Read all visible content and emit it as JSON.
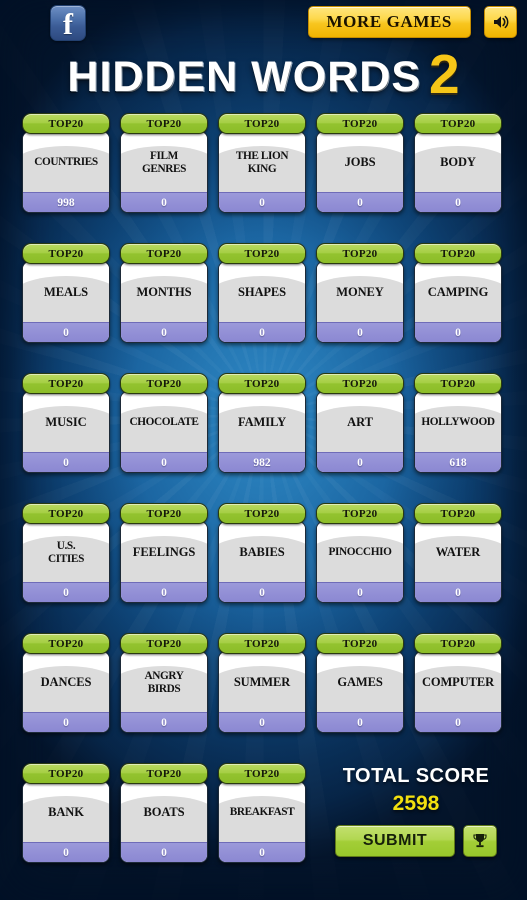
{
  "topbar": {
    "facebook_label": "f",
    "more_games_label": "MORE GAMES",
    "sound_icon": "speaker-icon"
  },
  "title": {
    "main": "HIDDEN WORDS",
    "number": "2"
  },
  "card_badge_label": "TOP20",
  "rows": [
    [
      {
        "title": "COUNTRIES",
        "score": "998",
        "badge": "TOP20"
      },
      {
        "title": "FILM\nGENRES",
        "score": "0",
        "badge": "TOP20"
      },
      {
        "title": "THE LION\nKING",
        "score": "0",
        "badge": "TOP20"
      },
      {
        "title": "JOBS",
        "score": "0",
        "badge": "TOP20"
      },
      {
        "title": "BODY",
        "score": "0",
        "badge": "TOP20"
      }
    ],
    [
      {
        "title": "MEALS",
        "score": "0",
        "badge": "TOP20"
      },
      {
        "title": "MONTHS",
        "score": "0",
        "badge": "TOP20"
      },
      {
        "title": "SHAPES",
        "score": "0",
        "badge": "TOP20"
      },
      {
        "title": "MONEY",
        "score": "0",
        "badge": "TOP20"
      },
      {
        "title": "CAMPING",
        "score": "0",
        "badge": "TOP20"
      }
    ],
    [
      {
        "title": "MUSIC",
        "score": "0",
        "badge": "TOP20"
      },
      {
        "title": "CHOCOLATE",
        "score": "0",
        "badge": "TOP20"
      },
      {
        "title": "FAMILY",
        "score": "982",
        "badge": "TOP20"
      },
      {
        "title": "ART",
        "score": "0",
        "badge": "TOP20"
      },
      {
        "title": "HOLLYWOOD",
        "score": "618",
        "badge": "TOP20"
      }
    ],
    [
      {
        "title": "U.S.\nCITIES",
        "score": "0",
        "badge": "TOP20"
      },
      {
        "title": "FEELINGS",
        "score": "0",
        "badge": "TOP20"
      },
      {
        "title": "BABIES",
        "score": "0",
        "badge": "TOP20"
      },
      {
        "title": "PINOCCHIO",
        "score": "0",
        "badge": "TOP20"
      },
      {
        "title": "WATER",
        "score": "0",
        "badge": "TOP20"
      }
    ],
    [
      {
        "title": "DANCES",
        "score": "0",
        "badge": "TOP20"
      },
      {
        "title": "ANGRY\nBIRDS",
        "score": "0",
        "badge": "TOP20"
      },
      {
        "title": "SUMMER",
        "score": "0",
        "badge": "TOP20"
      },
      {
        "title": "GAMES",
        "score": "0",
        "badge": "TOP20"
      },
      {
        "title": "COMPUTER",
        "score": "0",
        "badge": "TOP20"
      }
    ],
    [
      {
        "title": "BANK",
        "score": "0",
        "badge": "TOP20"
      },
      {
        "title": "BOATS",
        "score": "0",
        "badge": "TOP20"
      },
      {
        "title": "BREAKFAST",
        "score": "0",
        "badge": "TOP20"
      }
    ]
  ],
  "total": {
    "label": "TOTAL SCORE",
    "value": "2598",
    "submit_label": "SUBMIT",
    "trophy_icon": "trophy-icon"
  },
  "colors": {
    "background_blue": "#1a639f",
    "badge_green": "#a6cf45",
    "score_purple": "#9390d6",
    "accent_yellow": "#f6c618",
    "total_value_yellow": "#f2e00f"
  }
}
